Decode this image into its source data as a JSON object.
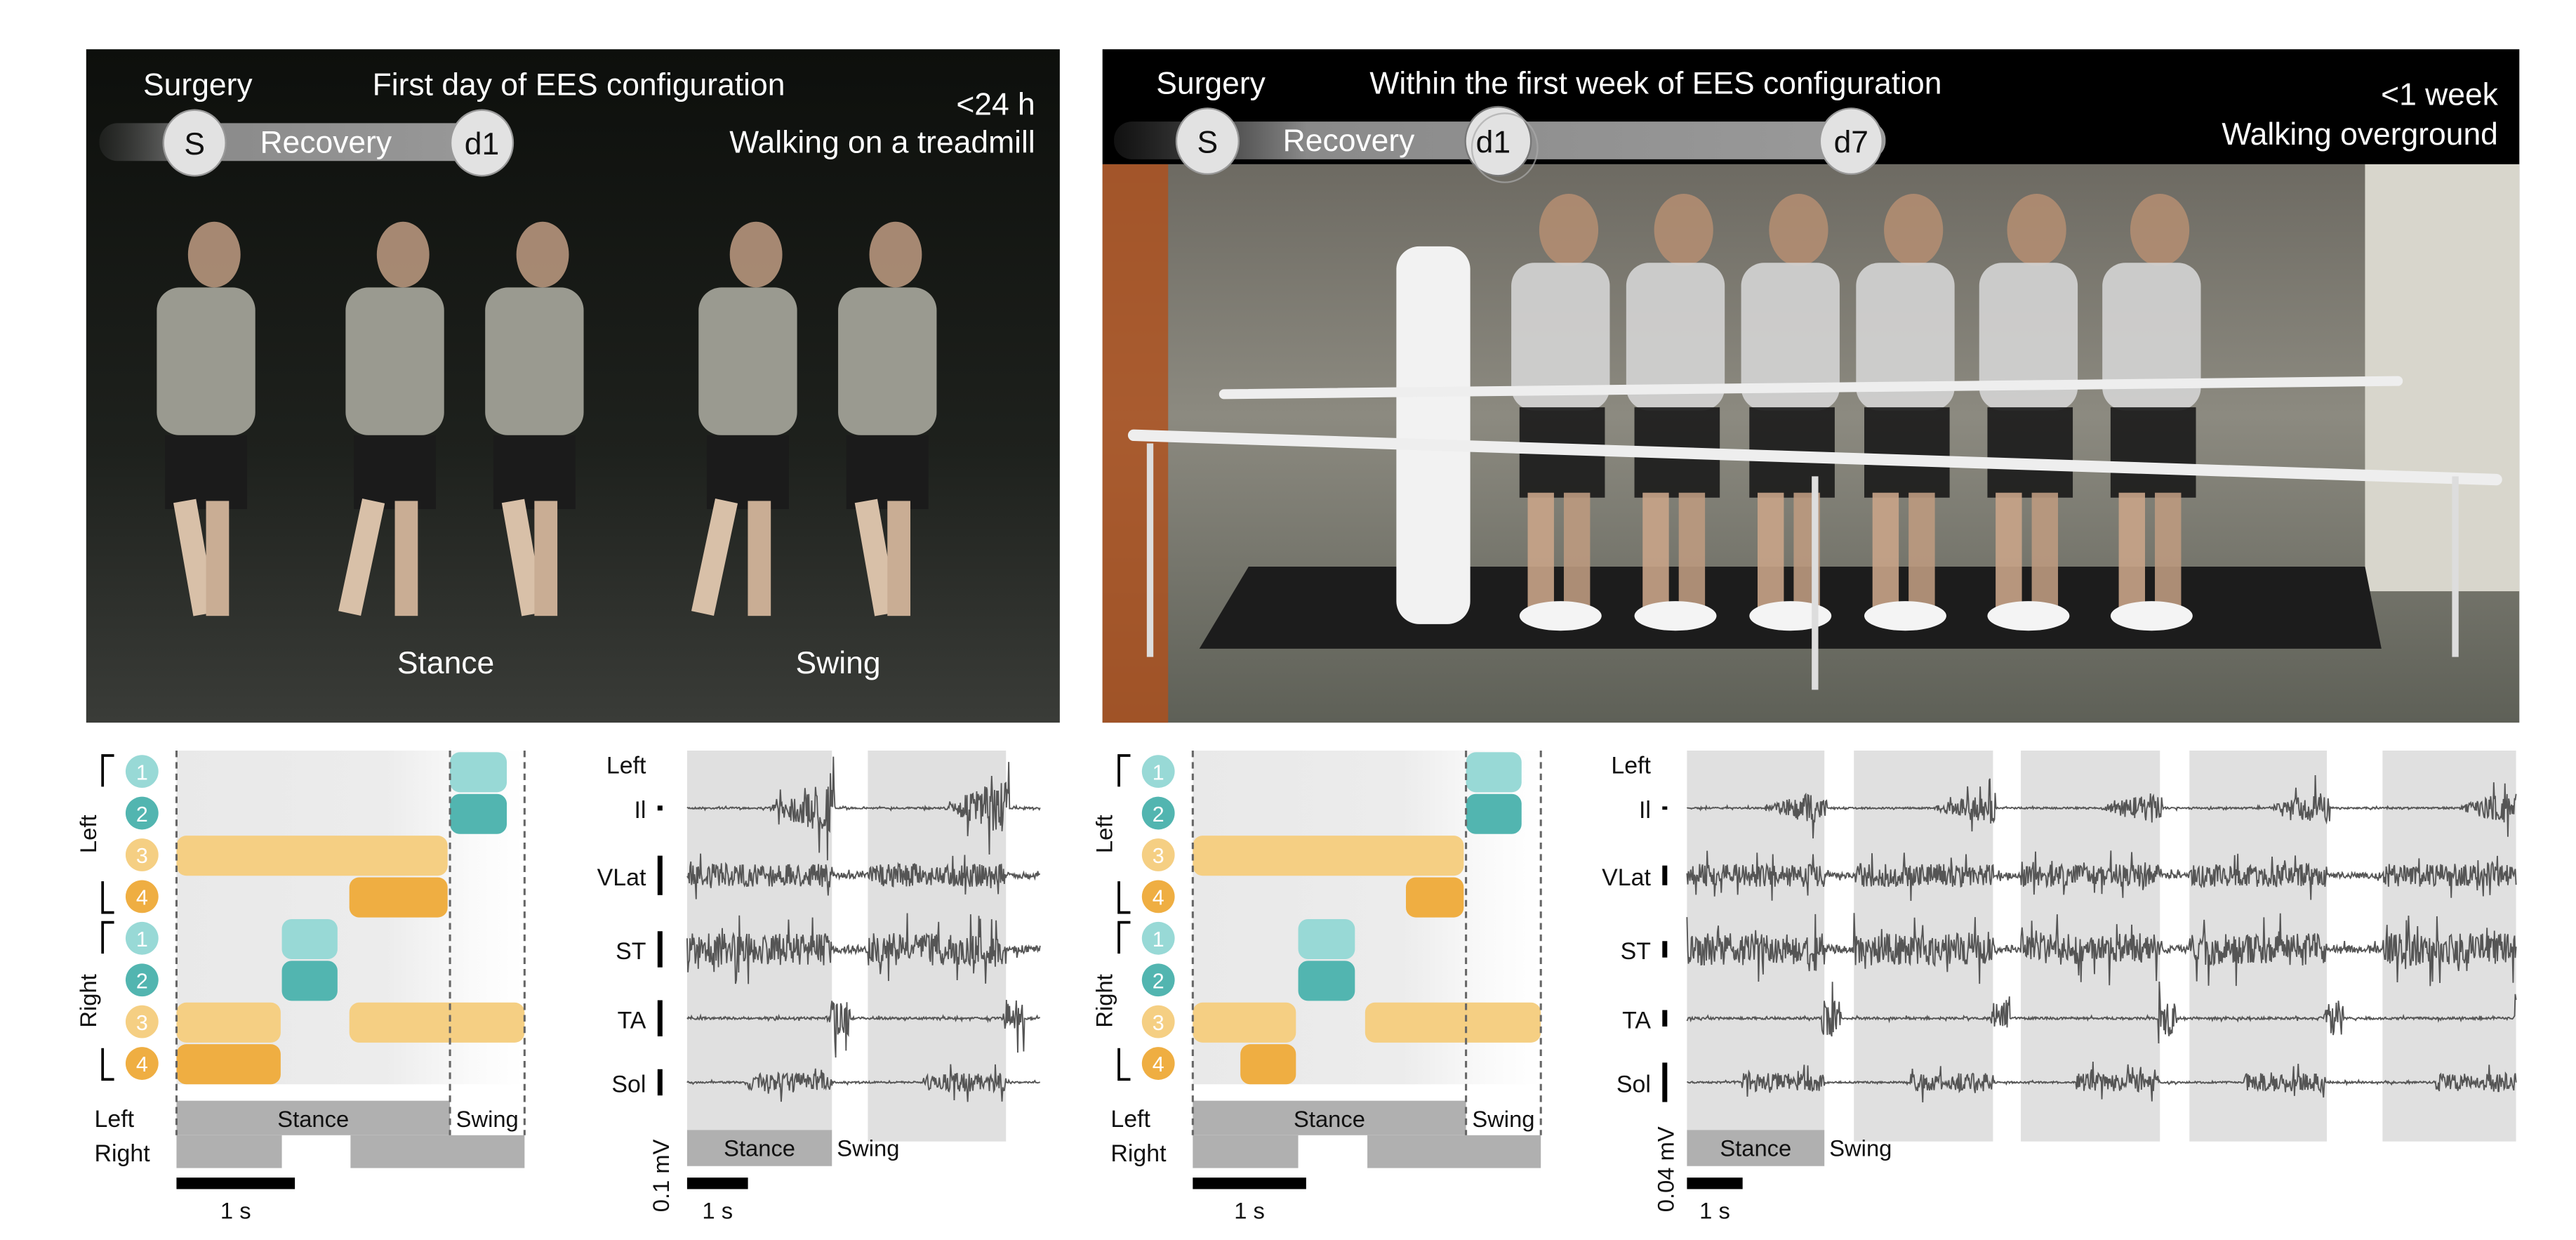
{
  "colors": {
    "light_teal": "#98d9d6",
    "teal": "#52b5b0",
    "light_yellow": "#f5cf83",
    "orange": "#efae42",
    "emg_trace": "#555555",
    "stance_shade": "#e0e0e0",
    "stance_box": "#b0b0b0"
  },
  "panels": [
    {
      "photo": {
        "surgery_label": "Surgery",
        "title": "First day of EES configuration",
        "time": "<24 h",
        "condition": "Walking on a treadmill",
        "timeline": {
          "start": "S",
          "phase": "Recovery",
          "markers": [
            "d1"
          ]
        },
        "phase_labels": [
          "Stance",
          "Swing"
        ]
      },
      "diagram": {
        "side_labels": [
          "Left",
          "Right"
        ],
        "duration_s": 2.94,
        "dividers_s": [
          0,
          2.31,
          2.94
        ],
        "rows": [
          {
            "side": "Left",
            "electrode": "1",
            "color": "light_teal",
            "segments": [
              [
                2.31,
                2.79
              ]
            ]
          },
          {
            "side": "Left",
            "electrode": "2",
            "color": "teal",
            "segments": [
              [
                2.31,
                2.79
              ]
            ]
          },
          {
            "side": "Left",
            "electrode": "3",
            "color": "light_yellow",
            "segments": [
              [
                0,
                2.29
              ]
            ]
          },
          {
            "side": "Left",
            "electrode": "4",
            "color": "orange",
            "segments": [
              [
                1.46,
                2.29
              ]
            ]
          },
          {
            "side": "Right",
            "electrode": "1",
            "color": "light_teal",
            "segments": [
              [
                0.89,
                1.36
              ]
            ]
          },
          {
            "side": "Right",
            "electrode": "2",
            "color": "teal",
            "segments": [
              [
                0.89,
                1.36
              ]
            ]
          },
          {
            "side": "Right",
            "electrode": "3",
            "color": "light_yellow",
            "segments": [
              [
                0,
                0.88
              ],
              [
                1.46,
                2.94
              ]
            ]
          },
          {
            "side": "Right",
            "electrode": "4",
            "color": "orange",
            "segments": [
              [
                0,
                0.88
              ]
            ]
          }
        ],
        "gait": {
          "left_label": "Left",
          "right_label": "Right",
          "left_stance_s": [
            [
              0,
              2.31
            ]
          ],
          "right_stance_s": [
            [
              0,
              0.89
            ],
            [
              1.47,
              2.94
            ]
          ],
          "stance_label": "Stance",
          "swing_label": "Swing"
        },
        "scale_bar": {
          "value_s": 1,
          "label": "1 s"
        }
      },
      "emg": {
        "side_label": "Left",
        "muscles": [
          "Il",
          "VLat",
          "ST",
          "TA",
          "Sol"
        ],
        "duration_s": 5.8,
        "stance_periods_s": [
          [
            0,
            2.38
          ],
          [
            2.97,
            5.24
          ]
        ],
        "stance_label": "Stance",
        "swing_label": "Swing",
        "amplitude_scale": "0.1 mV",
        "time_scale": {
          "value_s": 1,
          "label": "1 s"
        }
      }
    },
    {
      "photo": {
        "surgery_label": "Surgery",
        "title": "Within the first week of EES configuration",
        "time": "<1 week",
        "condition": "Walking overground",
        "timeline": {
          "start": "S",
          "phase": "Recovery",
          "markers": [
            "d1",
            "d7"
          ]
        }
      },
      "diagram": {
        "side_labels": [
          "Left",
          "Right"
        ],
        "duration_s": 3.07,
        "dividers_s": [
          0,
          2.41,
          3.07
        ],
        "rows": [
          {
            "side": "Left",
            "electrode": "1",
            "color": "light_teal",
            "segments": [
              [
                2.41,
                2.9
              ]
            ]
          },
          {
            "side": "Left",
            "electrode": "2",
            "color": "teal",
            "segments": [
              [
                2.41,
                2.9
              ]
            ]
          },
          {
            "side": "Left",
            "electrode": "3",
            "color": "light_yellow",
            "segments": [
              [
                0,
                2.39
              ]
            ]
          },
          {
            "side": "Left",
            "electrode": "4",
            "color": "orange",
            "segments": [
              [
                1.88,
                2.39
              ]
            ]
          },
          {
            "side": "Right",
            "electrode": "1",
            "color": "light_teal",
            "segments": [
              [
                0.93,
                1.43
              ]
            ]
          },
          {
            "side": "Right",
            "electrode": "2",
            "color": "teal",
            "segments": [
              [
                0.93,
                1.43
              ]
            ]
          },
          {
            "side": "Right",
            "electrode": "3",
            "color": "light_yellow",
            "segments": [
              [
                0,
                0.91
              ],
              [
                1.52,
                3.07
              ]
            ]
          },
          {
            "side": "Right",
            "electrode": "4",
            "color": "orange",
            "segments": [
              [
                0.42,
                0.91
              ]
            ]
          }
        ],
        "gait": {
          "left_label": "Left",
          "right_label": "Right",
          "left_stance_s": [
            [
              0,
              2.41
            ]
          ],
          "right_stance_s": [
            [
              0,
              0.93
            ],
            [
              1.54,
              3.07
            ]
          ],
          "stance_label": "Stance",
          "swing_label": "Swing"
        },
        "scale_bar": {
          "value_s": 1,
          "label": "1 s"
        }
      },
      "emg": {
        "side_label": "Left",
        "muscles": [
          "Il",
          "VLat",
          "ST",
          "TA",
          "Sol"
        ],
        "duration_s": 14.9,
        "stance_periods_s": [
          [
            0,
            2.47
          ],
          [
            3.0,
            5.5
          ],
          [
            6.0,
            8.5
          ],
          [
            9.03,
            11.5
          ],
          [
            12.5,
            14.9
          ]
        ],
        "stance_label": "Stance",
        "swing_label": "Swing",
        "amplitude_scale": "0.04 mV",
        "time_scale": {
          "value_s": 1,
          "label": "1 s"
        }
      }
    }
  ]
}
